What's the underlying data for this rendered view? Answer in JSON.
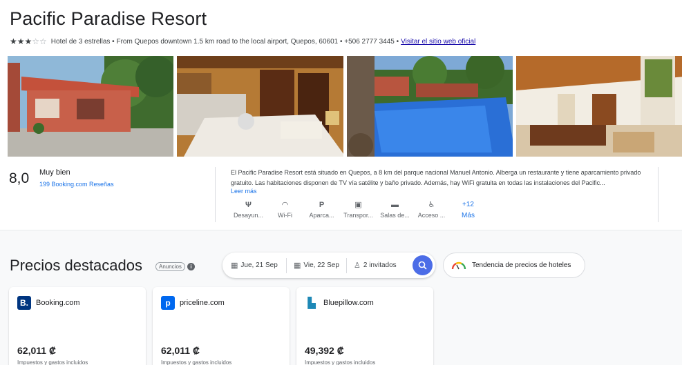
{
  "hotel": {
    "name": "Pacific Paradise Resort",
    "stars_filled": "★★★",
    "stars_empty": "☆☆",
    "subtitle": "Hotel de 3 estrellas • From Quepos downtown 1.5 km road to the local airport, Quepos, 60601 • +506 2777 3445 •",
    "website_link": "Visitar el sitio web oficial"
  },
  "photos": [
    "exterior",
    "habitacion",
    "piscina",
    "sala"
  ],
  "rating": {
    "score": "8,0",
    "verdict": "Muy bien",
    "reviews": "199 Booking.com Reseñas"
  },
  "description": {
    "text": "El Pacific Paradise Resort está situado en Quepos, a 8 km del parque nacional Manuel Antonio. Alberga un restaurante y tiene aparcamiento privado gratuito. Las habitaciones disponen de TV vía satélite y baño privado. Además, hay WiFi gratuita en todas las instalaciones del Pacific...",
    "more": "Leer más"
  },
  "amenities": [
    {
      "icon": "fork-knife-icon",
      "glyph": "Ψ",
      "label": "Desayun..."
    },
    {
      "icon": "wifi-icon",
      "glyph": "◠",
      "label": "Wi-Fi"
    },
    {
      "icon": "parking-icon",
      "glyph": "P",
      "label": "Aparca..."
    },
    {
      "icon": "bus-icon",
      "glyph": "▣",
      "label": "Transpor..."
    },
    {
      "icon": "briefcase-icon",
      "glyph": "▬",
      "label": "Salas de..."
    },
    {
      "icon": "accessible-icon",
      "glyph": "♿",
      "label": "Acceso ..."
    }
  ],
  "amenities_more": {
    "count": "+12",
    "label": "Más"
  },
  "prices": {
    "title": "Precios destacados",
    "ads_badge": "Anuncios",
    "checkin": "Jue, 21 Sep",
    "checkout": "Vie, 22 Sep",
    "guests": "2 invitados",
    "trend_label": "Tendencia de precios de hoteles"
  },
  "providers": [
    {
      "name": "Booking.com",
      "logo_letter": "B.",
      "logo_color": "#003580",
      "price": "62,011 ₡",
      "tax": "Impuestos y gastos incluidos"
    },
    {
      "name": "priceline.com",
      "logo_letter": "p",
      "logo_color": "#0068ef",
      "price": "62,011 ₡",
      "tax": "Impuestos y gastos incluidos"
    },
    {
      "name": "Bluepillow.com",
      "logo_letter": "▙",
      "logo_color": "#1e88b6",
      "price": "49,392 ₡",
      "tax": "Impuestos y gastos incluidos"
    }
  ]
}
